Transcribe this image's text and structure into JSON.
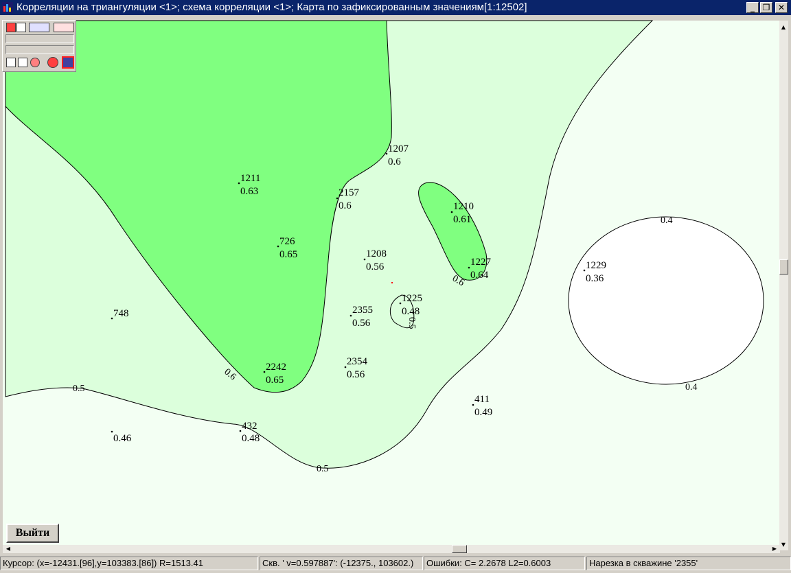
{
  "window": {
    "title": "Корреляции на триангуляции <1>; схема корреляции <1>; Карта по зафиксированным значениям[1:12502]",
    "minimize_glyph": "_",
    "restore_glyph": "❐",
    "close_glyph": "✕"
  },
  "colors": {
    "titlebar": "#0a246a",
    "map_background": "#f3fff3",
    "zone_0_5": "#dcffdc",
    "zone_0_6": "#80ff80",
    "zone_0_4": "#ffffff",
    "contour": "#000000",
    "cursor_marker": "#ff0000"
  },
  "toolbar": {
    "icons": [
      "move-icon",
      "frame-icon",
      "pan-zoom-icon",
      "zoom-out-icon",
      "close-map-icon",
      "properties-icon",
      "stop-icon",
      "target-icon",
      "map-view-icon"
    ]
  },
  "map": {
    "wells": [
      {
        "id": "1207",
        "value": "0.6"
      },
      {
        "id": "1211",
        "value": "0.63"
      },
      {
        "id": "2157",
        "value": "0.6"
      },
      {
        "id": "1210",
        "value": "0.61"
      },
      {
        "id": "726",
        "value": "0.65"
      },
      {
        "id": "1208",
        "value": "0.56"
      },
      {
        "id": "1227",
        "value": "0.64"
      },
      {
        "id": "1229",
        "value": "0.36"
      },
      {
        "id": "1225",
        "value": "0.48"
      },
      {
        "id": "2355",
        "value": "0.56"
      },
      {
        "id": "748",
        "value": ""
      },
      {
        "id": "2242",
        "value": "0.65"
      },
      {
        "id": "2354",
        "value": "0.56"
      },
      {
        "id": "411",
        "value": "0.49"
      },
      {
        "id": "",
        "value": "0.46"
      },
      {
        "id": "432",
        "value": "0.48"
      }
    ],
    "contour_labels": {
      "c1": "0.5",
      "c2": "0.5",
      "c3": "0.6",
      "c4": "0.6",
      "c5": "0.4",
      "c6": "0.4",
      "c7": "0.5"
    }
  },
  "buttons": {
    "exit_label": "Выйти"
  },
  "status": {
    "cursor": "Курсор: (x=-12431.[96],y=103383.[86]) R=1513.41",
    "well": "Скв. ' v=0.597887': (-12375., 103602.)",
    "errors": "Ошибки: C=  2.2678 L2=0.6003",
    "slice": "Нарезка в скважине '2355'"
  }
}
